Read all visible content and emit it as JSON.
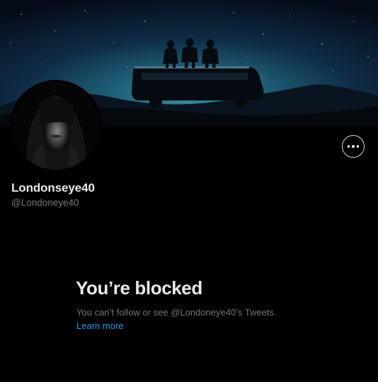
{
  "profile": {
    "display_name": "Londonseye40",
    "handle": "@Londoneye40"
  },
  "icons": {
    "more": "more-horizontal-icon"
  },
  "blocked": {
    "title": "You’re blocked",
    "message": "You can’t follow or see @Londoneye40’s Tweets.",
    "learn_more": "Learn more"
  },
  "colors": {
    "background": "#000000",
    "primary_text": "#e7e9ea",
    "secondary_text": "#71767b",
    "link": "#1d9bf0"
  }
}
